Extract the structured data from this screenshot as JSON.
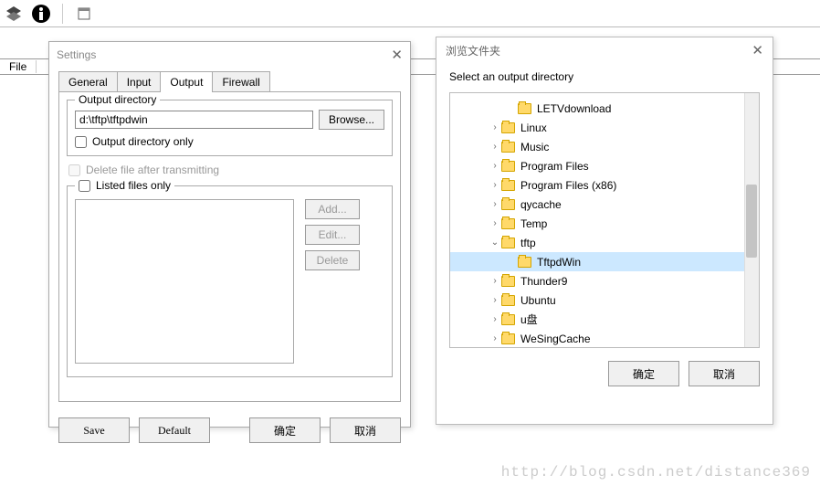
{
  "main": {
    "col_file_label": "File"
  },
  "settings": {
    "title": "Settings",
    "tabs": {
      "general": "General",
      "input": "Input",
      "output": "Output",
      "firewall": "Firewall"
    },
    "output_dir_group": "Output directory",
    "output_dir_value": "d:\\tftp\\tftpdwin",
    "browse_btn": "Browse...",
    "output_dir_only": "Output directory only",
    "delete_after": "Delete file after transmitting",
    "listed_only": "Listed files only",
    "add_btn": "Add...",
    "edit_btn": "Edit...",
    "delete_btn": "Delete",
    "save_btn": "Save",
    "default_btn": "Default",
    "ok_btn": "确定",
    "cancel_btn": "取消"
  },
  "browse": {
    "title": "浏览文件夹",
    "prompt": "Select an output directory",
    "ok_btn": "确定",
    "cancel_btn": "取消",
    "tree": [
      {
        "label": "LETVdownload",
        "indent": 60,
        "expander": ""
      },
      {
        "label": "Linux",
        "indent": 42,
        "expander": "›"
      },
      {
        "label": "Music",
        "indent": 42,
        "expander": "›"
      },
      {
        "label": "Program Files",
        "indent": 42,
        "expander": "›"
      },
      {
        "label": "Program Files (x86)",
        "indent": 42,
        "expander": "›"
      },
      {
        "label": "qycache",
        "indent": 42,
        "expander": "›"
      },
      {
        "label": "Temp",
        "indent": 42,
        "expander": "›"
      },
      {
        "label": "tftp",
        "indent": 42,
        "expander": "⌄",
        "selected": false
      },
      {
        "label": "TftpdWin",
        "indent": 60,
        "expander": "",
        "selected": true
      },
      {
        "label": "Thunder9",
        "indent": 42,
        "expander": "›"
      },
      {
        "label": "Ubuntu",
        "indent": 42,
        "expander": "›"
      },
      {
        "label": "u盘",
        "indent": 42,
        "expander": "›"
      },
      {
        "label": "WeSingCache",
        "indent": 42,
        "expander": "›"
      }
    ]
  },
  "watermark": "http://blog.csdn.net/distance369"
}
